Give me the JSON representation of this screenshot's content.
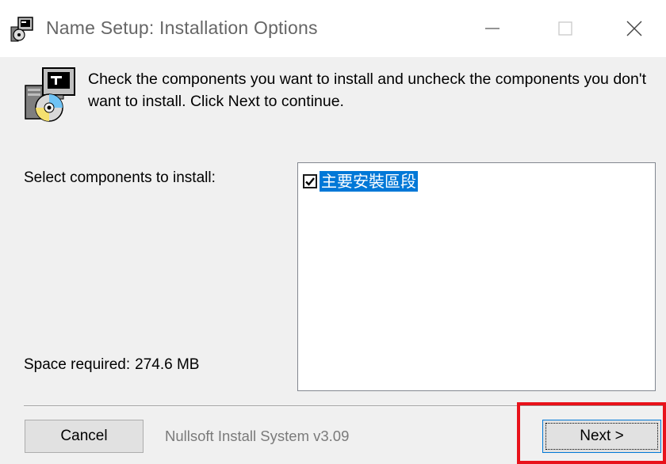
{
  "window": {
    "title": "Name Setup: Installation Options",
    "controls": {
      "minimize": "minimize",
      "maximize": "maximize",
      "close": "close"
    }
  },
  "header": {
    "description": "Check the components you want to install and uncheck the components you don't want to install. Click Next to continue."
  },
  "components": {
    "select_label": "Select components to install:",
    "space_label": "Space required:",
    "space_value": "274.6 MB",
    "items": [
      {
        "label": "主要安裝區段",
        "checked": true,
        "selected": true
      }
    ]
  },
  "footer": {
    "cancel_label": "Cancel",
    "branding": "Nullsoft Install System v3.09",
    "next_label": "Next >"
  },
  "colors": {
    "selection": "#0078d7",
    "highlight": "#e8121b",
    "background": "#f0f0f0"
  },
  "icons": [
    "installer-icon",
    "installer-disc-icon",
    "minimize-icon",
    "maximize-icon",
    "close-icon",
    "checkbox-checked-icon"
  ]
}
